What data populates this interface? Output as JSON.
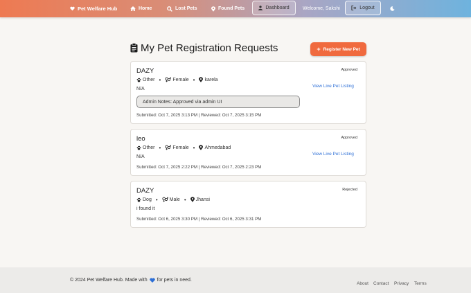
{
  "nav": {
    "brand": "Pet Welfare Hub",
    "home": "Home",
    "lost": "Lost Pets",
    "found": "Found Pets",
    "dashboard": "Dashboard",
    "welcome": "Welcome, Sakshi",
    "logout": "Logout"
  },
  "header": {
    "title": "My Pet Registration Requests",
    "register_label": "Register New Pet"
  },
  "requests": [
    {
      "name": "DAZY",
      "type": "Other",
      "gender": "Female",
      "location": "karela",
      "description": "N/A",
      "status": "Approved",
      "link": "View Live Pet Listing",
      "notes": "Admin Notes: Approved via admin UI",
      "dates": "Submitted: Oct 7, 2025 3:13 PM | Reviewed: Oct 7, 2025 3:15 PM"
    },
    {
      "name": "leo",
      "type": "Other",
      "gender": "Female",
      "location": "Ahmedabad",
      "description": "N/A",
      "status": "Approved",
      "link": "View Live Pet Listing",
      "dates": "Submitted: Oct 7, 2025 2:22 PM | Reviewed: Oct 7, 2025 2:23 PM"
    },
    {
      "name": "DAZY",
      "type": "Dog",
      "gender": "Male",
      "location": "Jhansi",
      "description": "i found it",
      "status": "Rejected",
      "dates": "Submitted: Oct 6, 2025 3:30 PM | Reviewed: Oct 6, 2025 3:31 PM"
    }
  ],
  "footer": {
    "copyright_pre": "© 2024 Pet Welfare Hub. Made with",
    "copyright_post": "for pets in need.",
    "links": [
      "About",
      "Contact",
      "Privacy",
      "Terms"
    ]
  },
  "colors": {
    "accent": "#f06a3e",
    "link": "#2d6fd6",
    "heart": "#2d6fd6"
  },
  "icons": {
    "brand": "heart-icon",
    "home": "house-icon",
    "lost": "search-icon",
    "found": "map-pin-icon",
    "dashboard": "user-icon",
    "logout": "sign-out-icon",
    "theme": "moon-icon",
    "title": "clipboard-icon",
    "type": "paw-icon",
    "gender": "gender-icon",
    "location": "map-pin-icon"
  }
}
